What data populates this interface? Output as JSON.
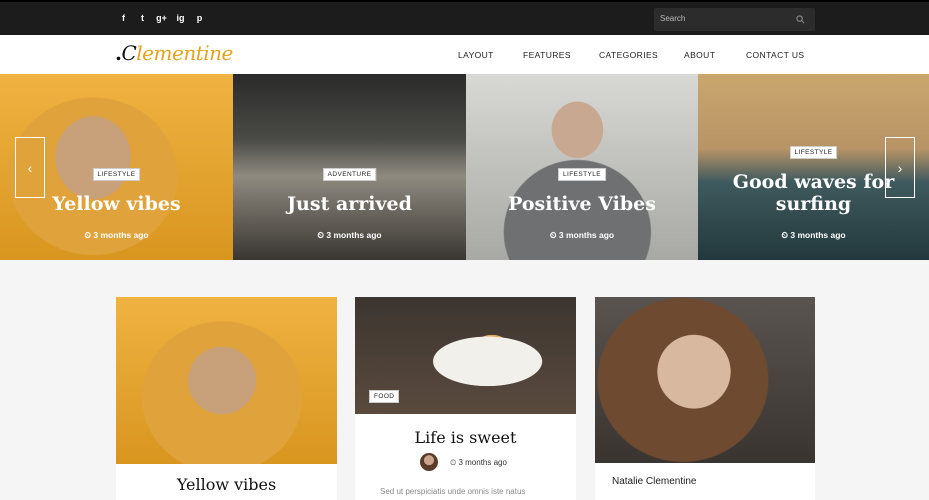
{
  "social": [
    "f",
    "t",
    "g+",
    "ig",
    "p"
  ],
  "search": {
    "placeholder": "Search",
    "icon": "search-icon"
  },
  "logo": {
    "dot": ".",
    "c": "C",
    "rest": "lementine"
  },
  "nav": [
    "LAYOUT",
    "FEATURES",
    "CATEGORIES",
    "ABOUT",
    "CONTACT US"
  ],
  "slides": [
    {
      "category": "LIFESTYLE",
      "title": "Yellow vibes",
      "meta": "⏲ 3 months ago"
    },
    {
      "category": "ADVENTURE",
      "title": "Just arrived",
      "meta": "⏲ 3 months ago"
    },
    {
      "category": "LIFESTYLE",
      "title": "Positive Vibes",
      "meta": "⏲ 3 months ago"
    },
    {
      "category": "LIFESTYLE",
      "title": "Good waves for surfing",
      "meta": "⏲ 3 months ago"
    }
  ],
  "arrows": {
    "prev": "‹",
    "next": "›"
  },
  "cards": [
    {
      "title": "Yellow vibes"
    },
    {
      "category": "FOOD",
      "title": "Life is sweet",
      "time": "⏲  3 months ago",
      "excerpt": "Sed ut perspiciatis unde omnis iste natus"
    },
    {
      "author": "Natalie Clementine"
    }
  ],
  "colors": {
    "accent": "#e6a21b",
    "topbar": "#1c1c1c"
  }
}
